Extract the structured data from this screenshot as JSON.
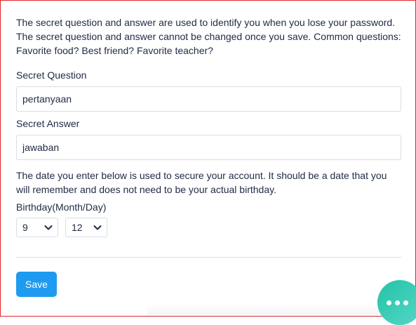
{
  "intro_text": "The secret question and answer are used to identify you when you lose your password. The secret question and answer cannot be changed once you save. Common questions: Favorite food? Best friend? Favorite teacher?",
  "secret_question": {
    "label": "Secret Question",
    "value": "pertanyaan"
  },
  "secret_answer": {
    "label": "Secret Answer",
    "value": "jawaban"
  },
  "birthday_text": "The date you enter below is used to secure your account. It should be a date that you will remember and does not need to be your actual birthday.",
  "birthday": {
    "label": "Birthday(Month/Day)",
    "month": "9",
    "day": "12"
  },
  "save_label": "Save",
  "colors": {
    "accent": "#1e9bf0",
    "chat": "#22c4a6",
    "frame_border": "#e3262b"
  },
  "icons": {
    "dropdown": "chevron-down-icon",
    "chat": "more-dots-icon"
  }
}
